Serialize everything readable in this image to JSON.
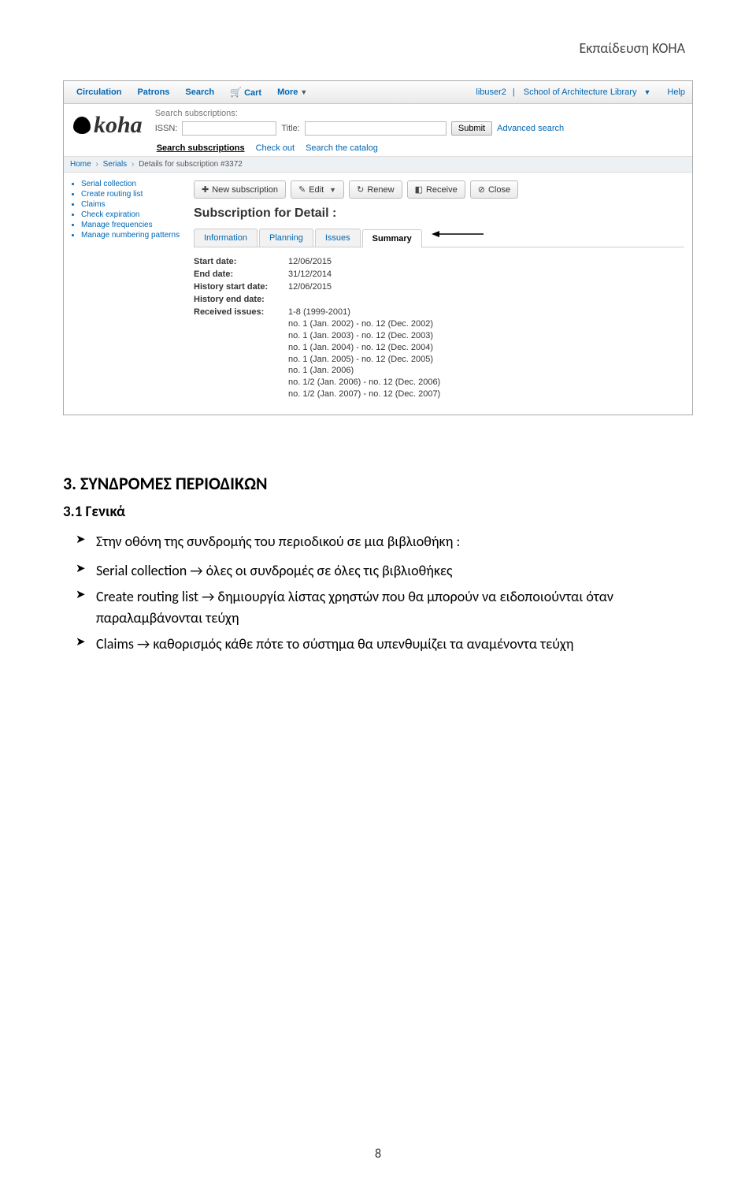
{
  "doc_header": "Εκπαίδευση KOHA",
  "topnav": {
    "items": [
      "Circulation",
      "Patrons",
      "Search",
      "Cart",
      "More"
    ],
    "user": "libuser2",
    "library": "School of Architecture Library",
    "help": "Help"
  },
  "logo": "koha",
  "search": {
    "prompt": "Search subscriptions:",
    "issn_label": "ISSN:",
    "title_label": "Title:",
    "submit": "Submit",
    "advanced": "Advanced search",
    "tabs": [
      "Search subscriptions",
      "Check out",
      "Search the catalog"
    ]
  },
  "breadcrumb": {
    "home": "Home",
    "serials": "Serials",
    "detail": "Details for subscription #3372"
  },
  "sidebar": {
    "items": [
      "Serial collection",
      "Create routing list",
      "Claims",
      "Check expiration",
      "Manage frequencies",
      "Manage numbering patterns"
    ]
  },
  "toolbar": {
    "new": "New subscription",
    "edit": "Edit",
    "renew": "Renew",
    "receive": "Receive",
    "close": "Close"
  },
  "heading": "Subscription for Detail :",
  "tabs": [
    "Information",
    "Planning",
    "Issues",
    "Summary"
  ],
  "summary": {
    "start_label": "Start date:",
    "start_val": "12/06/2015",
    "end_label": "End date:",
    "end_val": "31/12/2014",
    "hist_start_label": "History start date:",
    "hist_start_val": "12/06/2015",
    "hist_end_label": "History end date:",
    "hist_end_val": "",
    "recv_label": "Received issues:",
    "recv_val": "1-8 (1999-2001)"
  },
  "issues_lines": [
    "no. 1 (Jan. 2002) - no. 12 (Dec. 2002)",
    "no. 1 (Jan. 2003) - no. 12 (Dec. 2003)",
    "no. 1 (Jan. 2004) - no. 12 (Dec. 2004)",
    "no. 1 (Jan. 2005) - no. 12 (Dec. 2005)",
    "no. 1 (Jan. 2006)",
    "no. 1/2 (Jan. 2006) - no. 12 (Dec. 2006)",
    "no. 1/2 (Jan. 2007) - no. 12 (Dec. 2007)"
  ],
  "body": {
    "h2": "3. ΣΥΝΔΡΟΜΕΣ ΠΕΡΙΟΔΙΚΩΝ",
    "h3": "3.1 Γενικά",
    "b1": "Στην οθόνη της συνδρομής του περιοδικού σε μια βιβλιοθήκη :",
    "b2": "Serial collection → όλες οι συνδρομές σε όλες τις βιβλιοθήκες",
    "b3": "Create routing list → δημιουργία λίστας χρηστών που θα μπορούν να ειδοποιούνται όταν παραλαμβάνονται τεύχη",
    "b4": "Claims   → καθορισμός κάθε πότε το σύστημα θα υπενθυμίζει τα αναμένοντα τεύχη"
  },
  "page_number": "8"
}
